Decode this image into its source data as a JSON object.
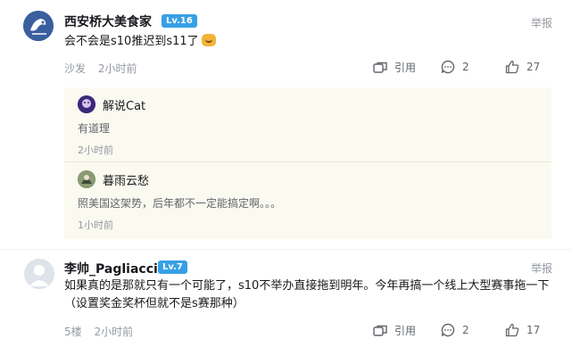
{
  "comments": [
    {
      "username": "西安桥大美食家",
      "level": "Lv.16",
      "text": "会不会是s10推迟到s11了",
      "floor": "沙发",
      "time": "2小时前",
      "quote_label": "引用",
      "reply_count": "2",
      "like_count": "27",
      "report_label": "举报",
      "replies": [
        {
          "username": "解说Cat",
          "text": "有道理",
          "time": "2小时前"
        },
        {
          "username": "暮雨云愁",
          "text": "照美国这架势，后年都不一定能搞定啊。。。",
          "time": "1小时前"
        }
      ]
    },
    {
      "username": "李帅_Pagliacci",
      "level": "Lv.7",
      "text": "如果真的是那就只有一个可能了，s10不举办直接拖到明年。今年再搞一个线上大型赛事拖一下（设置奖金奖杯但就不是s赛那种）",
      "floor": "5楼",
      "time": "2小时前",
      "quote_label": "引用",
      "reply_count": "2",
      "like_count": "17",
      "report_label": "举报"
    }
  ],
  "colors": {
    "level_badge": "#37a0e6",
    "reply_bg": "#fbfaf1",
    "meta": "#9499a0"
  },
  "icons": [
    "quote-icon",
    "reply-bubble-icon",
    "thumbs-up-icon",
    "laughing-emoji-icon"
  ]
}
